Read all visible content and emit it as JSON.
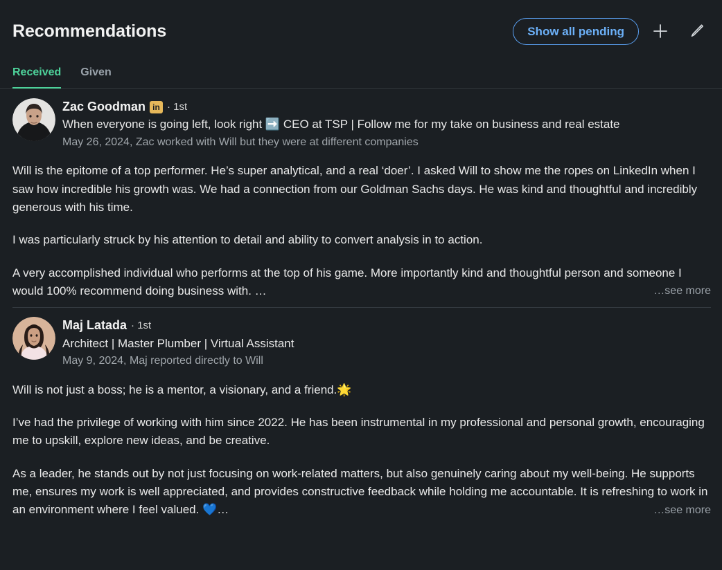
{
  "header": {
    "title": "Recommendations",
    "show_all_pending_label": "Show all pending",
    "add_icon": "plus-icon",
    "edit_icon": "pencil-icon"
  },
  "tabs": [
    {
      "label": "Received",
      "active": true
    },
    {
      "label": "Given",
      "active": false
    }
  ],
  "colors": {
    "background": "#1b1f23",
    "accent_green": "#4ed39b",
    "accent_blue": "#6cb0f7",
    "badge_gold": "#e7b85a",
    "text_primary": "#e9e9e9",
    "text_muted": "#a0a6ab",
    "divider": "#343a40"
  },
  "recommendations": [
    {
      "name": "Zac Goodman",
      "badge": "in",
      "degree": "· 1st",
      "headline": "When everyone is going left, look right ➡️ CEO at TSP | Follow me for my take on business and real estate",
      "date_relation": "May 26, 2024, Zac worked with Will but they were at different companies",
      "paragraphs": [
        "Will is the epitome of a top performer. He’s super analytical, and a real ‘doer’. I asked Will to show me the ropes on LinkedIn when I saw how incredible his growth was. We had a connection from our Goldman Sachs days. He was kind and thoughtful and incredibly generous with his time.",
        "I was particularly struck by his attention to detail and ability to convert analysis in to action.",
        "A very accomplished individual who performs at the top of his game. More importantly kind and thoughtful person and someone I would 100% recommend doing business with. …"
      ],
      "see_more_label": "…see more"
    },
    {
      "name": "Maj Latada",
      "badge": "",
      "degree": "· 1st",
      "headline": "Architect | Master Plumber | Virtual Assistant",
      "date_relation": "May 9, 2024, Maj reported directly to Will",
      "paragraphs": [
        "Will is not just a boss; he is a mentor, a visionary, and a friend.🌟",
        "I’ve had the privilege of working with him since 2022. He has been instrumental in my professional and personal growth, encouraging me to upskill, explore new ideas, and be creative.",
        "As a leader, he stands out by not just focusing on work-related matters, but also genuinely caring about my well-being. He supports me, ensures my work is well appreciated, and provides constructive feedback while holding me accountable. It is refreshing to work in an environment where I feel valued. 💙…"
      ],
      "see_more_label": "…see more"
    }
  ]
}
